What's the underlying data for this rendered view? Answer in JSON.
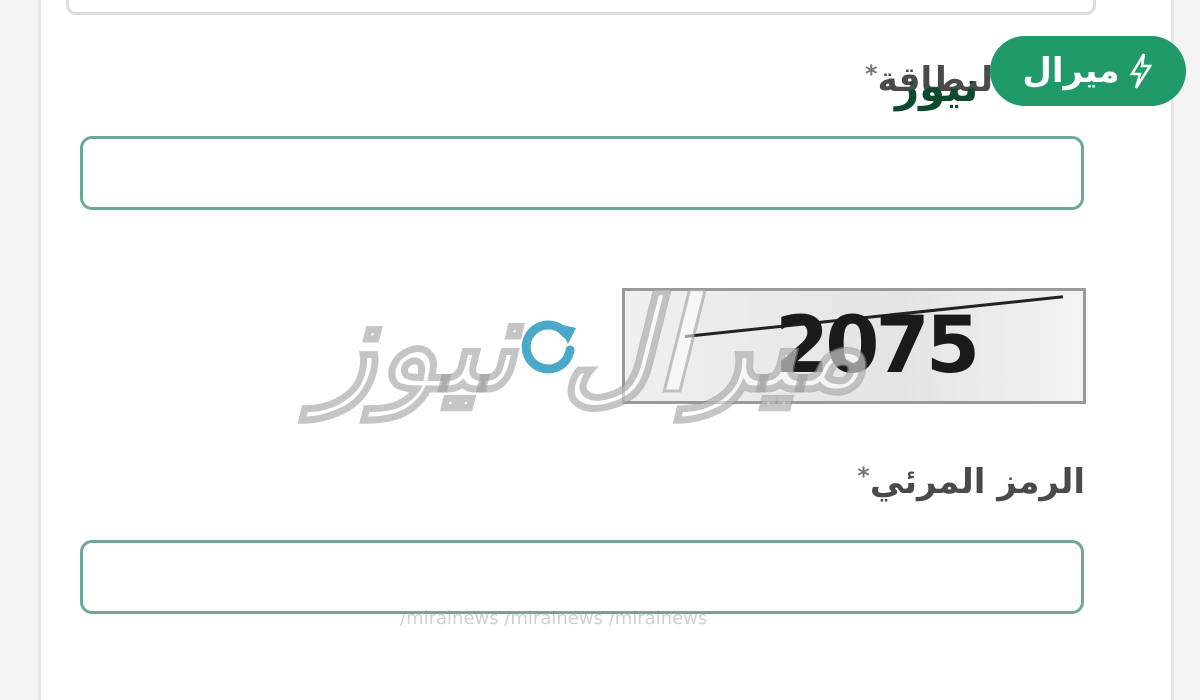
{
  "brand": {
    "name": "ميرال",
    "overlay": "نيوز"
  },
  "form": {
    "card_label": "رقم البطاقة",
    "card_required": "*",
    "card_value": "",
    "captcha_label": "الرمز المرئي",
    "captcha_required": "*",
    "captcha_value": "",
    "captcha_image_text": "2075"
  },
  "watermark": {
    "text": "ميرال نيوز",
    "social": "/miralnews   /miralnews   /miralnews"
  },
  "colors": {
    "brand_green": "#1f9a68",
    "input_border": "#6fa89a",
    "refresh_icon": "#4aa8c8"
  },
  "icons": {
    "refresh": "refresh-icon",
    "lightning": "lightning-icon"
  }
}
